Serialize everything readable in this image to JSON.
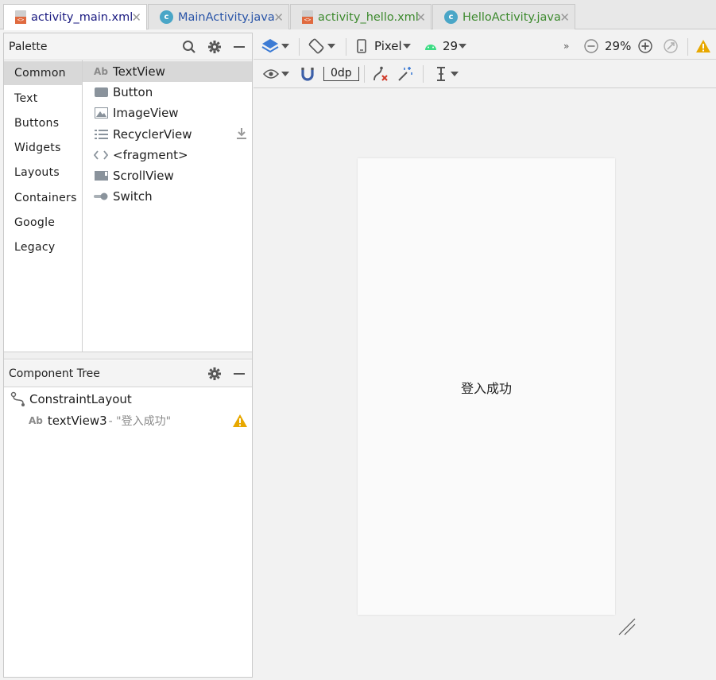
{
  "tabs": [
    {
      "label": "activity_main.xml",
      "type": "xml",
      "active": true,
      "color": "#1a1a80"
    },
    {
      "label": "MainActivity.java",
      "type": "java",
      "active": false,
      "color": "#2a55a8"
    },
    {
      "label": "activity_hello.xml",
      "type": "xml",
      "active": false,
      "color": "#3d8a2e"
    },
    {
      "label": "HelloActivity.java",
      "type": "java",
      "active": false,
      "color": "#3d8a2e"
    }
  ],
  "palette": {
    "title": "Palette",
    "categories": [
      "Common",
      "Text",
      "Buttons",
      "Widgets",
      "Layouts",
      "Containers",
      "Google",
      "Legacy"
    ],
    "selected_category": "Common",
    "items": [
      {
        "label": "TextView",
        "icon": "ab-icon"
      },
      {
        "label": "Button",
        "icon": "button-icon"
      },
      {
        "label": "ImageView",
        "icon": "image-icon"
      },
      {
        "label": "RecyclerView",
        "icon": "list-icon"
      },
      {
        "label": "<fragment>",
        "icon": "code-icon"
      },
      {
        "label": "ScrollView",
        "icon": "scroll-icon"
      },
      {
        "label": "Switch",
        "icon": "switch-icon"
      }
    ],
    "selected_item": "TextView"
  },
  "component_tree": {
    "title": "Component Tree",
    "root": "ConstraintLayout",
    "child_id": "textView3",
    "child_hint": "- \"登入成功\""
  },
  "toolbar": {
    "device": "Pixel",
    "api": "29",
    "zoom": "29%",
    "margin": "0dp"
  },
  "design": {
    "text": "登入成功"
  },
  "colors": {
    "warning": "#e8a800",
    "android_green": "#3ddc84",
    "layers_blue": "#3c7bd4"
  }
}
